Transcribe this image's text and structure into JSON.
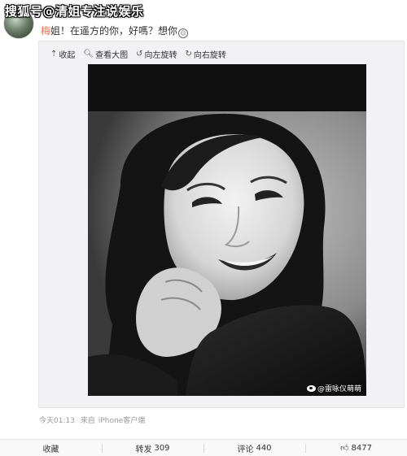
{
  "watermark": "搜狐号@清姐专注说娱乐",
  "post": {
    "mention": "梅",
    "text": "姐！在遥方的你，好嗎？想你",
    "emoji": "smile-emoji"
  },
  "media_toolbar": {
    "collapse_label": "收起",
    "view_large_label": "查看大图",
    "rotate_left_label": "向左旋转",
    "rotate_right_label": "向右旋转"
  },
  "photo": {
    "credit": "@雷咏仪萌萌",
    "description_icon": "weibo-icon"
  },
  "meta": {
    "time": "今天01:13",
    "source_prefix": "来自",
    "source": "iPhone客户端"
  },
  "actions": {
    "favorite_label": "收藏",
    "repost_label": "转发",
    "repost_count": "309",
    "comment_label": "评论",
    "comment_count": "440",
    "like_count": "8477"
  }
}
